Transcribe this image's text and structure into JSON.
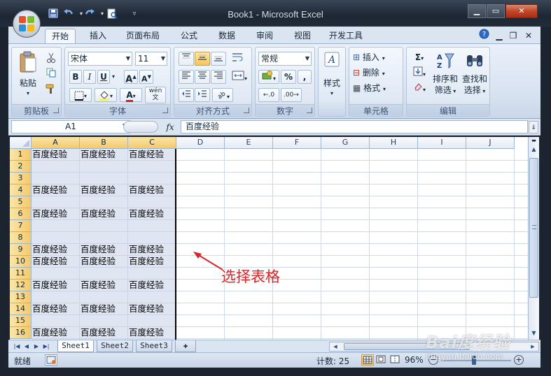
{
  "window": {
    "title": "Book1 - Microsoft Excel"
  },
  "ribbon_tabs": [
    {
      "label": "开始",
      "active": true
    },
    {
      "label": "插入"
    },
    {
      "label": "页面布局"
    },
    {
      "label": "公式"
    },
    {
      "label": "数据"
    },
    {
      "label": "审阅"
    },
    {
      "label": "视图"
    },
    {
      "label": "开发工具"
    }
  ],
  "groups": {
    "clipboard": {
      "label": "剪贴板",
      "paste": "粘贴"
    },
    "font": {
      "label": "字体",
      "font_name": "宋体",
      "font_size": "11",
      "bold": "B",
      "italic": "I",
      "underline": "U",
      "grow": "A",
      "shrink": "A",
      "font_color_letter": "A",
      "wen": "wén\n文"
    },
    "alignment": {
      "label": "对齐方式"
    },
    "number": {
      "label": "数字",
      "format": "常规",
      "percent": "%",
      "comma": ","
    },
    "styles": {
      "label": "样式"
    },
    "cells": {
      "label": "单元格",
      "insert": "插入",
      "delete": "删除",
      "format": "格式"
    },
    "editing": {
      "label": "编辑",
      "sort_filter_line1": "排序和",
      "sort_filter_line2": "筛选",
      "find_select_line1": "查找和",
      "find_select_line2": "选择",
      "sigma": "Σ"
    }
  },
  "formula_bar": {
    "name_box": "A1",
    "fx": "fx",
    "formula": "百度经验"
  },
  "grid": {
    "columns": [
      "A",
      "B",
      "C",
      "D",
      "E",
      "F",
      "G",
      "H",
      "I",
      "J"
    ],
    "selected_columns": [
      "A",
      "B",
      "C"
    ],
    "rows": [
      "1",
      "2",
      "3",
      "4",
      "5",
      "6",
      "7",
      "8",
      "9",
      "10",
      "11",
      "12",
      "13",
      "14",
      "15",
      "16"
    ],
    "cell_text": "百度经验",
    "filled_rows": [
      "1",
      "4",
      "6",
      "9",
      "10",
      "12",
      "14",
      "16"
    ]
  },
  "sheets": [
    {
      "label": "Sheet1",
      "active": true
    },
    {
      "label": "Sheet2"
    },
    {
      "label": "Sheet3"
    }
  ],
  "status": {
    "ready": "就绪",
    "count": "计数: 25",
    "zoom": "96%"
  },
  "annotation": "选择表格",
  "watermark": {
    "brand": "Bai度经验",
    "url": "jingyan.baidu.com"
  },
  "colors": {
    "selection_header": "#f4c96b",
    "annotation": "#d6262a",
    "ribbon": "#dbe4f1"
  }
}
